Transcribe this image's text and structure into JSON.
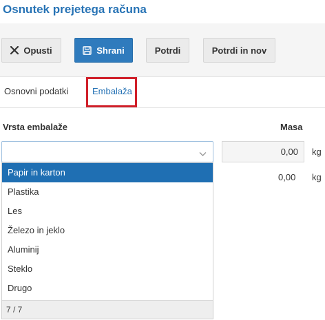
{
  "page": {
    "title": "Osnutek prejetega računa"
  },
  "toolbar": {
    "discard_label": "Opusti",
    "save_label": "Shrani",
    "confirm_label": "Potrdi",
    "confirm_new_label": "Potrdi in nov"
  },
  "tabs": [
    {
      "label": "Osnovni podatki",
      "active": false
    },
    {
      "label": "Embalaža",
      "active": true
    }
  ],
  "form": {
    "packaging_type_label": "Vrsta embalaže",
    "mass_label": "Masa",
    "rows": [
      {
        "mass_value": "0,00",
        "unit": "kg"
      },
      {
        "mass_value": "0,00",
        "unit": "kg"
      }
    ]
  },
  "dropdown": {
    "options": [
      "Papir in karton",
      "Plastika",
      "Les",
      "Železo in jeklo",
      "Aluminij",
      "Steklo",
      "Drugo"
    ],
    "selected_index": 0,
    "footer": "7 / 7"
  },
  "colors": {
    "accent": "#2773b5",
    "primary_button": "#2f7bbd",
    "selected_option": "#1f6fb3",
    "highlight_border": "#d0202a"
  },
  "icons": {
    "discard": "close-icon",
    "save": "floppy-disk-icon",
    "select": "chevron-down-icon"
  }
}
